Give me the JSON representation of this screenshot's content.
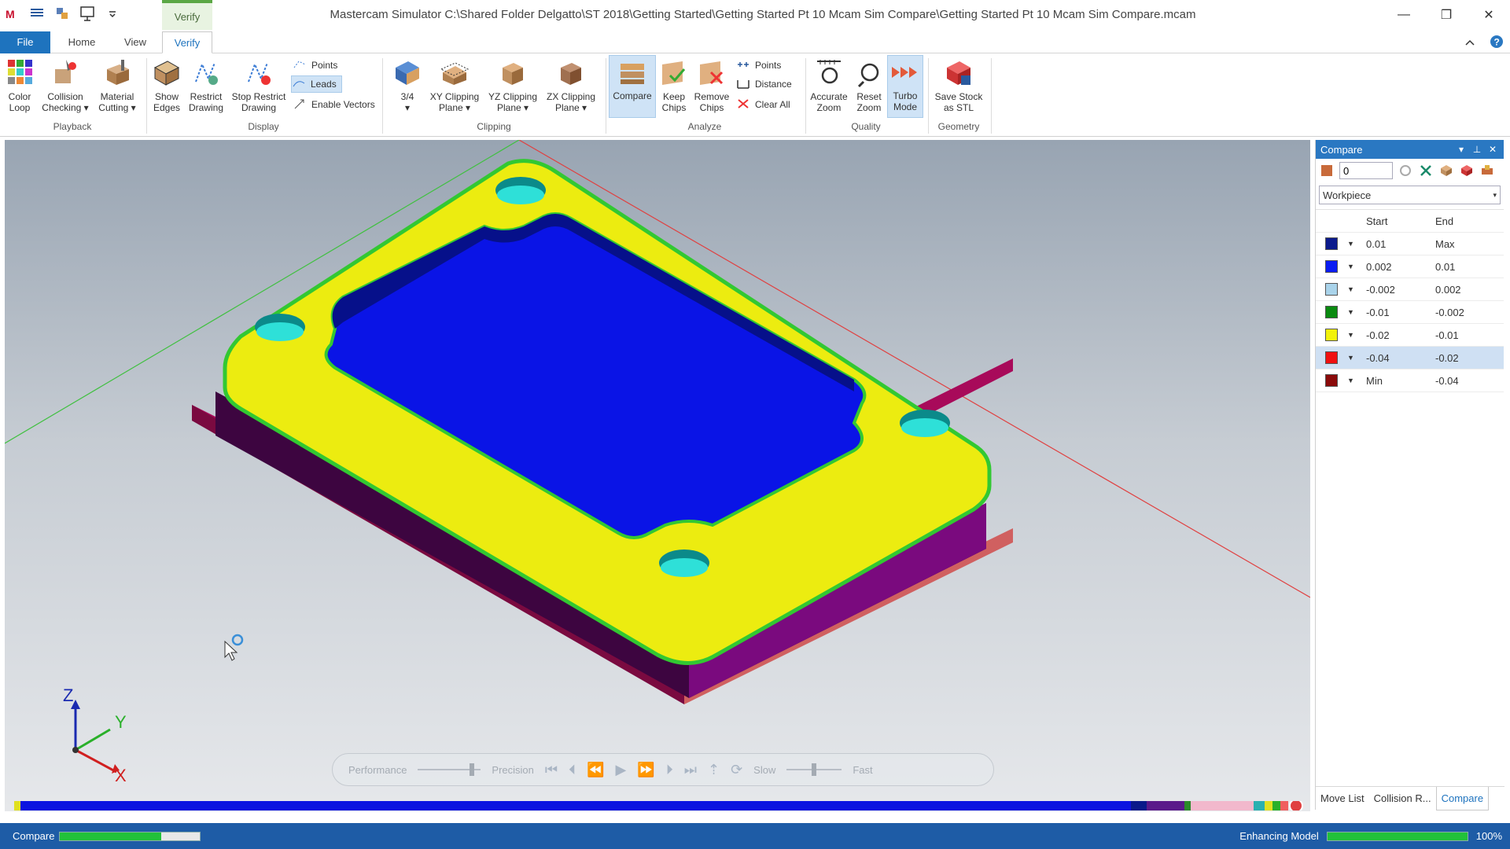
{
  "window": {
    "title": "Mastercam Simulator  C:\\Shared Folder Delgatto\\ST 2018\\Getting Started\\Getting Started Pt 10 Mcam Sim Compare\\Getting Started Pt 10 Mcam Sim Compare.mcam",
    "context_tab": "Verify",
    "minimize": "—",
    "restore": "❐",
    "close": "✕"
  },
  "ribbon_tabs": {
    "file": "File",
    "home": "Home",
    "view": "View",
    "verify": "Verify"
  },
  "ribbon": {
    "playback": {
      "label": "Playback",
      "color_loop": [
        "Color",
        "Loop"
      ],
      "collision_checking": [
        "Collision",
        "Checking ▾"
      ],
      "material_cutting": [
        "Material",
        "Cutting ▾"
      ]
    },
    "display": {
      "label": "Display",
      "show_edges": [
        "Show",
        "Edges"
      ],
      "restrict_drawing": [
        "Restrict",
        "Drawing"
      ],
      "stop_restrict_drawing": [
        "Stop Restrict",
        "Drawing"
      ],
      "points": "Points",
      "leads": "Leads",
      "enable_vectors": "Enable Vectors"
    },
    "clipping": {
      "label": "Clipping",
      "three_quarter": [
        "3/4",
        "▾"
      ],
      "xy_clipping": [
        "XY Clipping",
        "Plane ▾"
      ],
      "yz_clipping": [
        "YZ Clipping",
        "Plane ▾"
      ],
      "zx_clipping": [
        "ZX Clipping",
        "Plane ▾"
      ]
    },
    "analyze": {
      "label": "Analyze",
      "compare": "Compare",
      "keep_chips": [
        "Keep",
        "Chips"
      ],
      "remove_chips": [
        "Remove",
        "Chips"
      ],
      "points": "Points",
      "distance": "Distance",
      "clear_all": "Clear All"
    },
    "quality": {
      "label": "Quality",
      "accurate_zoom": [
        "Accurate",
        "Zoom"
      ],
      "reset_zoom": [
        "Reset",
        "Zoom"
      ],
      "turbo_mode": [
        "Turbo",
        "Mode"
      ]
    },
    "geometry": {
      "label": "Geometry",
      "save_stock": [
        "Save Stock",
        "as STL"
      ]
    }
  },
  "playbar": {
    "performance": "Performance",
    "precision": "Precision",
    "slow": "Slow",
    "fast": "Fast"
  },
  "axis_labels": {
    "x": "X",
    "y": "Y",
    "z": "Z"
  },
  "compare_panel": {
    "title": "Compare",
    "value": "0",
    "workpiece": "Workpiece",
    "col_start": "Start",
    "col_end": "End",
    "rows": [
      {
        "color": "#0b1a8c",
        "start": "0.01",
        "end": "Max"
      },
      {
        "color": "#0a1cf2",
        "start": "0.002",
        "end": "0.01"
      },
      {
        "color": "#a9d3ea",
        "start": "-0.002",
        "end": "0.002"
      },
      {
        "color": "#0a8a10",
        "start": "-0.01",
        "end": "-0.002"
      },
      {
        "color": "#f2f20a",
        "start": "-0.02",
        "end": "-0.01"
      },
      {
        "color": "#f01010",
        "start": "-0.04",
        "end": "-0.02"
      },
      {
        "color": "#8a0a0a",
        "start": "Min",
        "end": "-0.04"
      }
    ],
    "tabs": {
      "move_list": "Move List",
      "collision": "Collision R...",
      "compare": "Compare"
    }
  },
  "status": {
    "left_label": "Compare",
    "left_progress": 0.72,
    "right_label": "Enhancing Model",
    "right_percent": "100%",
    "right_progress": 1.0
  }
}
